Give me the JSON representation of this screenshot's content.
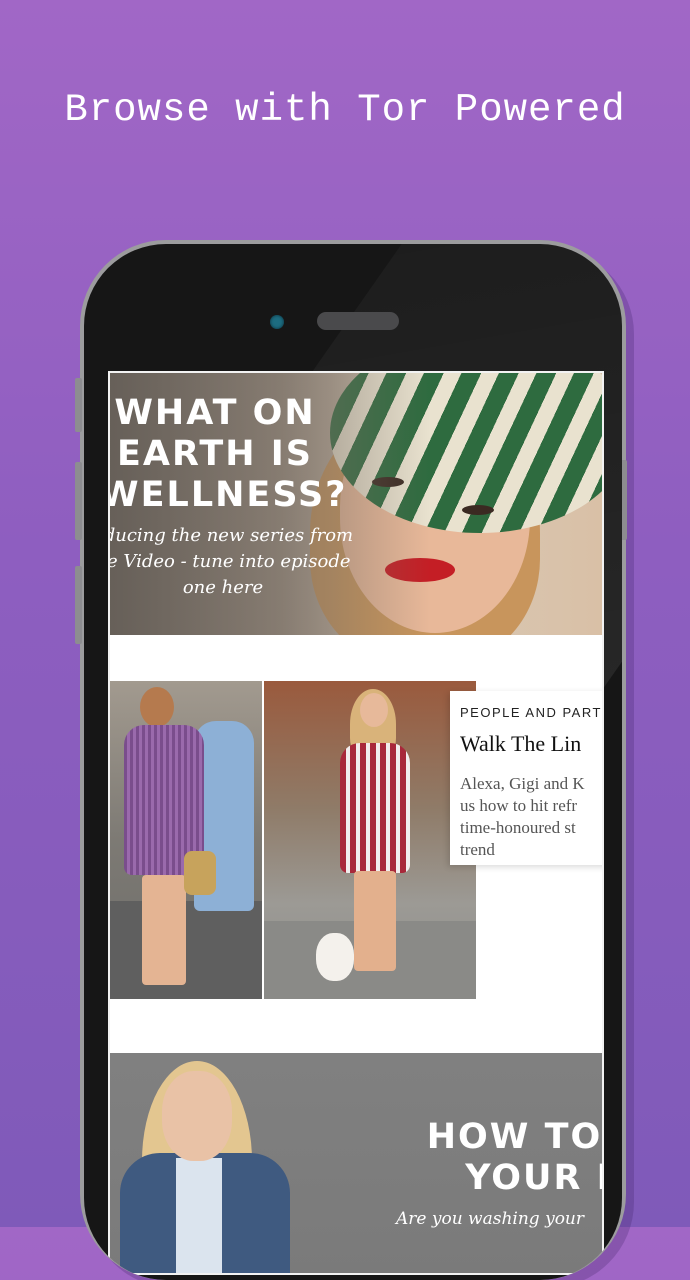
{
  "banner": {
    "headline": "Browse with Tor Powered"
  },
  "feed": {
    "hero": {
      "title_lines": [
        "WHAT ON",
        "EARTH IS",
        "WELLNESS?"
      ],
      "subtitle_lines": [
        "oducing the new series from",
        "ue Video - tune into episode",
        "one here"
      ]
    },
    "article": {
      "category": "PEOPLE AND PARTI",
      "title": "Walk The Lin",
      "excerpt_lines": [
        "Alexa, Gigi and K",
        "us how to hit refr",
        "time-honoured st",
        "trend"
      ]
    },
    "feature": {
      "title_lines": [
        "HOW TO W",
        "YOUR HA"
      ],
      "subtitle": "Are you washing your"
    }
  }
}
